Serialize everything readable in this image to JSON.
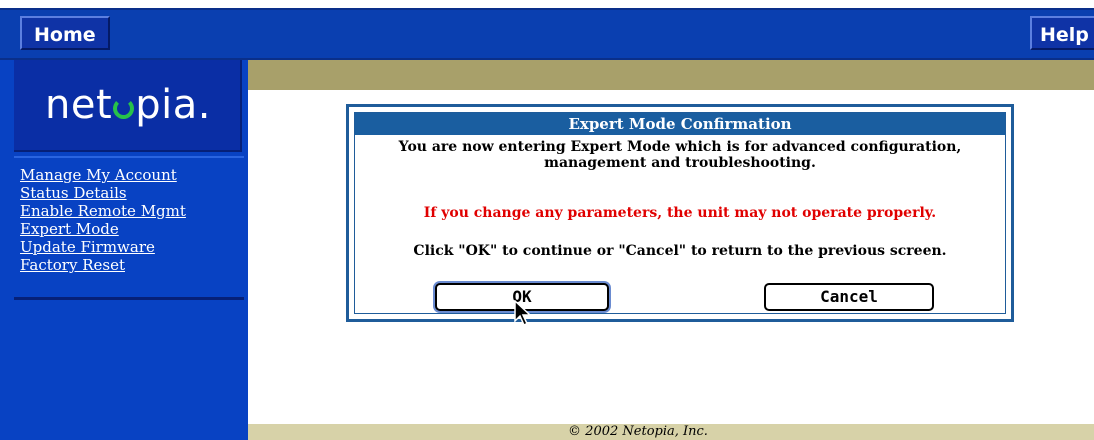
{
  "nav": {
    "home_label": "Home",
    "help_label": "Help"
  },
  "sidebar": {
    "logo": "netopia.",
    "items": [
      {
        "label": "Manage My Account"
      },
      {
        "label": "Status Details"
      },
      {
        "label": "Enable Remote Mgmt"
      },
      {
        "label": "Expert Mode"
      },
      {
        "label": "Update Firmware"
      },
      {
        "label": "Factory Reset"
      }
    ]
  },
  "dialog": {
    "title": "Expert Mode Confirmation",
    "line1": "You are now entering Expert Mode which is for advanced configuration, management and troubleshooting.",
    "warning": "If you change any parameters, the unit may not operate properly.",
    "instruction": "Click \"OK\" to continue or \"Cancel\" to return to the previous screen.",
    "ok_label": "OK",
    "cancel_label": "Cancel"
  },
  "footer": {
    "copyright": "© 2002 Netopia, Inc."
  },
  "colors": {
    "nav_blue": "#0a3fb0",
    "sidebar_blue": "#0842c3",
    "dialog_title_blue": "#1a5ea0",
    "warning_red": "#e00000",
    "olive": "#a8a06a"
  },
  "icons": {
    "cursor": "arrow-cursor-icon"
  }
}
